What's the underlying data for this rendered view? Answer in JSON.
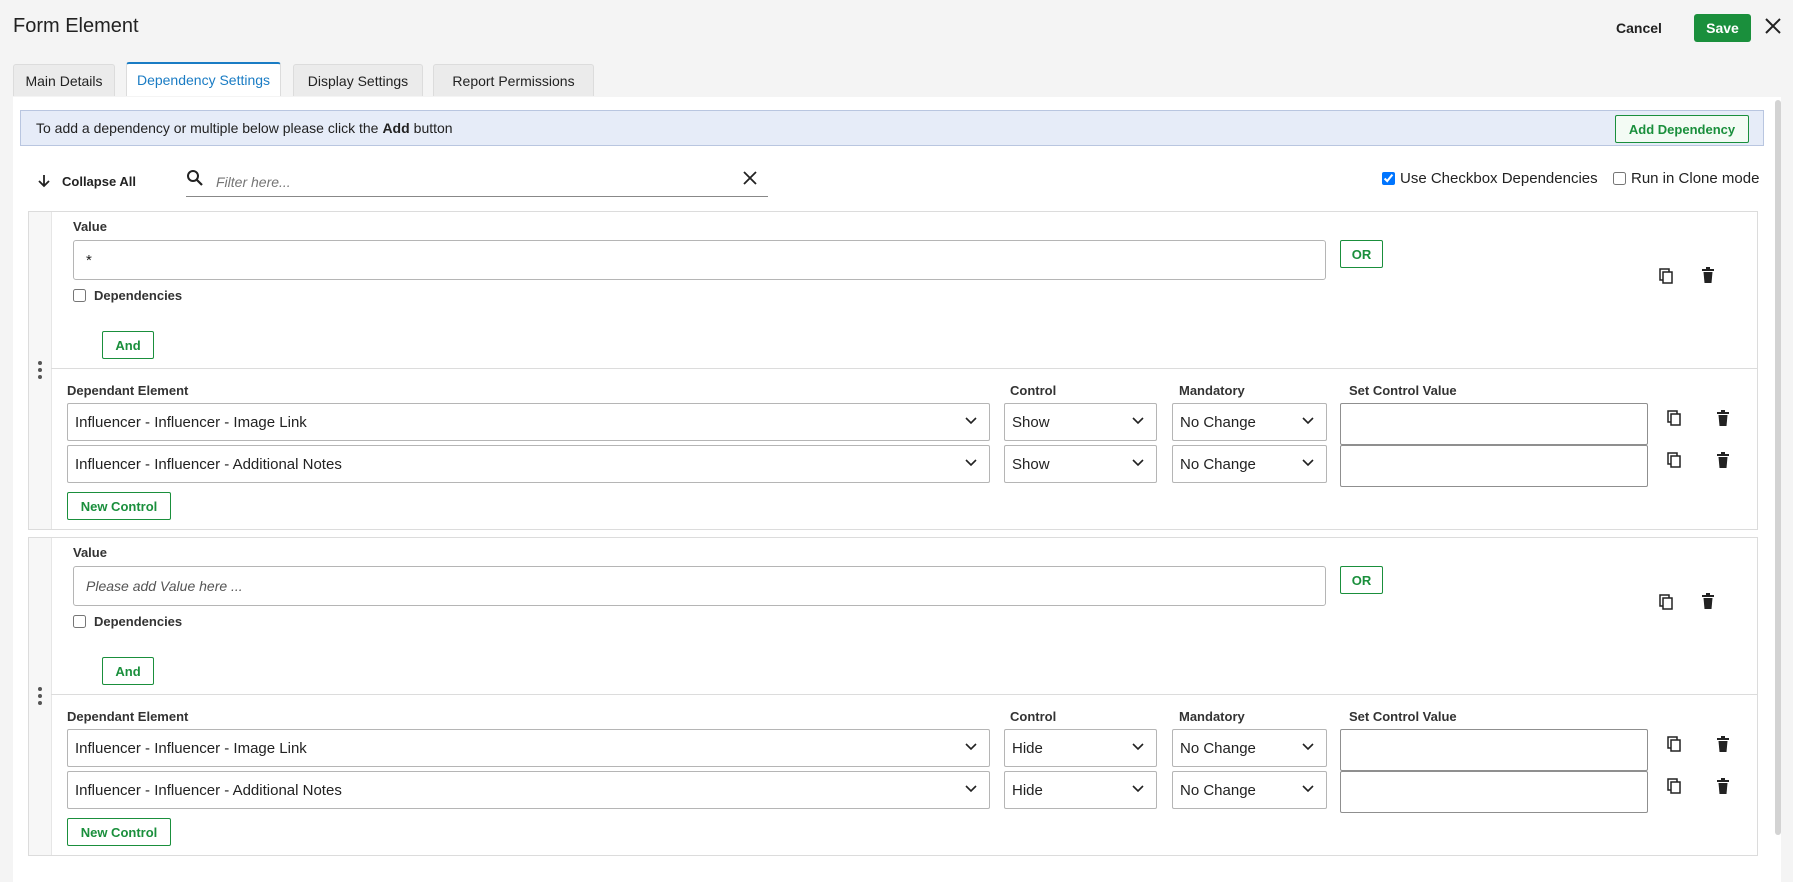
{
  "header": {
    "title": "Form Element",
    "cancel_label": "Cancel",
    "save_label": "Save"
  },
  "tabs": [
    {
      "label": "Main Details"
    },
    {
      "label": "Dependency Settings",
      "active": true
    },
    {
      "label": "Display Settings"
    },
    {
      "label": "Report Permissions"
    }
  ],
  "info": {
    "text_before": "To add a dependency or multiple below please click the",
    "text_bold": "Add",
    "text_after": "button",
    "add_dependency_label": "Add Dependency"
  },
  "toolbar": {
    "collapse_all_label": "Collapse All",
    "filter_placeholder": "Filter here...",
    "use_checkbox_deps_label": "Use Checkbox Dependencies",
    "use_checkbox_deps_checked": true,
    "run_clone_label": "Run in Clone mode",
    "run_clone_checked": false
  },
  "labels": {
    "value": "Value",
    "dependencies": "Dependencies",
    "or": "OR",
    "and": "And",
    "dependant_element": "Dependant Element",
    "control": "Control",
    "mandatory": "Mandatory",
    "set_control_value": "Set Control Value",
    "new_control": "New Control"
  },
  "dependencies": [
    {
      "value": "*",
      "value_placeholder": "Please add Value here ...",
      "dependencies_checked": false,
      "controls": [
        {
          "element": "Influencer - Influencer - Image Link",
          "control": "Show",
          "mandatory": "No Change",
          "set_value": ""
        },
        {
          "element": "Influencer - Influencer - Additional Notes",
          "control": "Show",
          "mandatory": "No Change",
          "set_value": ""
        }
      ]
    },
    {
      "value": "",
      "value_placeholder": "Please add Value here ...",
      "dependencies_checked": false,
      "controls": [
        {
          "element": "Influencer - Influencer - Image Link",
          "control": "Hide",
          "mandatory": "No Change",
          "set_value": ""
        },
        {
          "element": "Influencer - Influencer - Additional Notes",
          "control": "Hide",
          "mandatory": "No Change",
          "set_value": ""
        }
      ]
    }
  ],
  "colors": {
    "accent_green": "#1a8f3c",
    "tab_active_blue": "#1a7cc4",
    "info_bg": "#e6ecf8"
  }
}
